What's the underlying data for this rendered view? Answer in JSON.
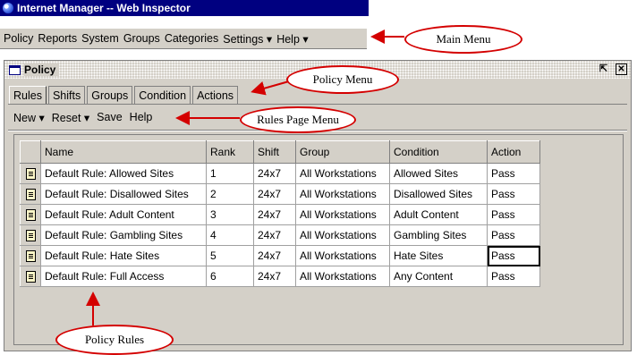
{
  "app": {
    "title": "Internet Manager -- Web Inspector",
    "icon": "globe-icon"
  },
  "main_menu": {
    "items": [
      "Policy",
      "Reports",
      "System",
      "Groups",
      "Categories",
      "Settings ▾",
      "Help ▾"
    ]
  },
  "policy_window": {
    "title": "Policy",
    "tabs": [
      "Rules",
      "Shifts",
      "Groups",
      "Condition",
      "Actions"
    ],
    "active_tab": "Rules",
    "rules_menu": [
      "New ▾",
      "Reset ▾",
      "Save",
      "Help"
    ]
  },
  "table": {
    "headers": [
      "Name",
      "Rank",
      "Shift",
      "Group",
      "Condition",
      "Action"
    ],
    "rows": [
      [
        "Default Rule: Allowed Sites",
        "1",
        "24x7",
        "All Workstations",
        "Allowed Sites",
        "Pass"
      ],
      [
        "Default Rule: Disallowed Sites",
        "2",
        "24x7",
        "All Workstations",
        "Disallowed Sites",
        "Pass"
      ],
      [
        "Default Rule: Adult Content",
        "3",
        "24x7",
        "All Workstations",
        "Adult Content",
        "Pass"
      ],
      [
        "Default Rule: Gambling Sites",
        "4",
        "24x7",
        "All Workstations",
        "Gambling Sites",
        "Pass"
      ],
      [
        "Default Rule: Hate Sites",
        "5",
        "24x7",
        "All Workstations",
        "Hate Sites",
        "Pass"
      ],
      [
        "Default Rule: Full Access",
        "6",
        "24x7",
        "All Workstations",
        "Any Content",
        "Pass"
      ]
    ]
  },
  "callouts": {
    "main_menu": "Main Menu",
    "policy_menu": "Policy Menu",
    "rules_page_menu": "Rules Page Menu",
    "policy_rules": "Policy Rules"
  },
  "colors": {
    "title_bar": "#000080",
    "window_bg": "#d4d0c8",
    "callout_border": "#d40000"
  }
}
